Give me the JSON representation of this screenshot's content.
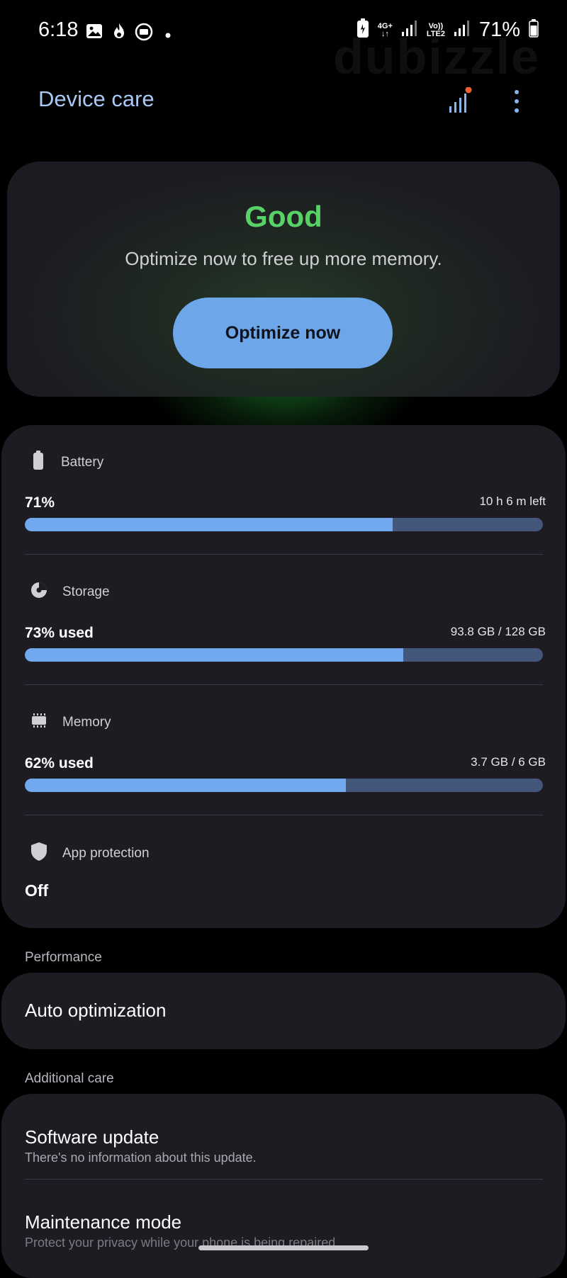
{
  "status_bar": {
    "time": "6:18",
    "network_type": "4G+",
    "volte_line1": "Vo))",
    "volte_line2": "LTE2",
    "battery_percent": "71%"
  },
  "header": {
    "title": "Device care",
    "diagnostics_icon": "signal-bars-icon",
    "more_icon": "more-vertical-icon"
  },
  "hero": {
    "status": "Good",
    "subtitle": "Optimize now to free up more memory.",
    "button_label": "Optimize now"
  },
  "battery": {
    "label": "Battery",
    "value": "71%",
    "detail": "10 h 6 m left",
    "fill_percent": 71
  },
  "storage": {
    "label": "Storage",
    "value": "73% used",
    "detail": "93.8 GB / 128 GB",
    "fill_percent": 73
  },
  "memory": {
    "label": "Memory",
    "value": "62% used",
    "detail": "3.7 GB / 6 GB",
    "fill_percent": 62
  },
  "app_protection": {
    "label": "App protection",
    "value": "Off"
  },
  "performance": {
    "section_title": "Performance",
    "auto_optimization": "Auto optimization"
  },
  "additional_care": {
    "section_title": "Additional care",
    "software_update_title": "Software update",
    "software_update_sub": "There's no information about this update.",
    "maintenance_title": "Maintenance mode",
    "maintenance_sub": "Protect your privacy while your phone is being repaired."
  },
  "colors": {
    "accent": "#6ea6ea",
    "good": "#58d267",
    "card": "#1e1b22",
    "bar_track": "#42577a",
    "bar_fill": "#72a9ee"
  }
}
